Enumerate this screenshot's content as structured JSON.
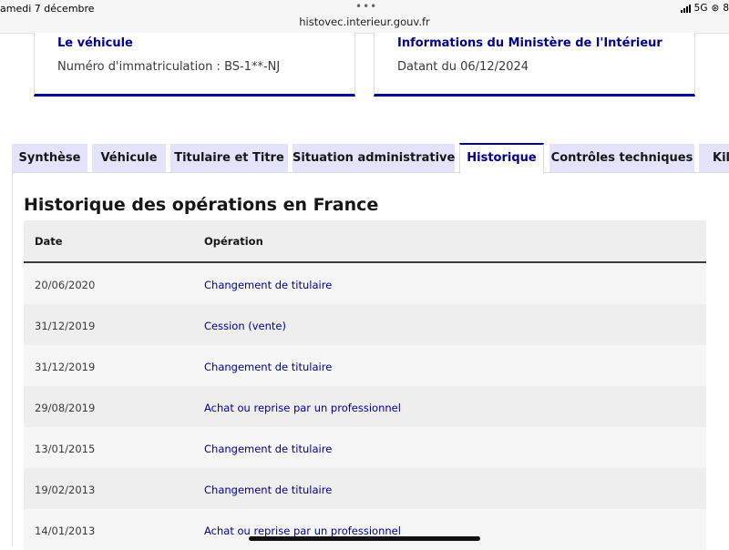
{
  "status_bar": {
    "date": "amedi 7 décembre",
    "url": "histovec.interieur.gouv.fr",
    "network": "5G",
    "battery_fragment": "8"
  },
  "cards": [
    {
      "title": "Le véhicule",
      "text": "Numéro d'immatriculation : BS-1**-NJ"
    },
    {
      "title": "Informations du Ministère de l'Intérieur",
      "text": "Datant du 06/12/2024"
    }
  ],
  "tabs": [
    {
      "label": "Synthèse",
      "active": false
    },
    {
      "label": "Véhicule",
      "active": false
    },
    {
      "label": "Titulaire et Titre",
      "active": false
    },
    {
      "label": "Situation administrative",
      "active": false
    },
    {
      "label": "Historique",
      "active": true
    },
    {
      "label": "Contrôles techniques",
      "active": false
    },
    {
      "label": "Kilo",
      "active": false
    }
  ],
  "section_title": "Historique des opérations en France",
  "table": {
    "headers": {
      "date": "Date",
      "operation": "Opération"
    },
    "rows": [
      {
        "date": "20/06/2020",
        "operation": "Changement de titulaire"
      },
      {
        "date": "31/12/2019",
        "operation": "Cession (vente)"
      },
      {
        "date": "31/12/2019",
        "operation": "Changement de titulaire"
      },
      {
        "date": "29/08/2019",
        "operation": "Achat ou reprise par un professionnel"
      },
      {
        "date": "13/01/2015",
        "operation": "Changement de titulaire"
      },
      {
        "date": "19/02/2013",
        "operation": "Changement de titulaire"
      },
      {
        "date": "14/01/2013",
        "operation": "Achat ou reprise par un professionnel"
      }
    ]
  },
  "colors": {
    "accent": "#000091",
    "tab_bg": "#e3e3fd",
    "header_bg": "#eeeeee"
  }
}
